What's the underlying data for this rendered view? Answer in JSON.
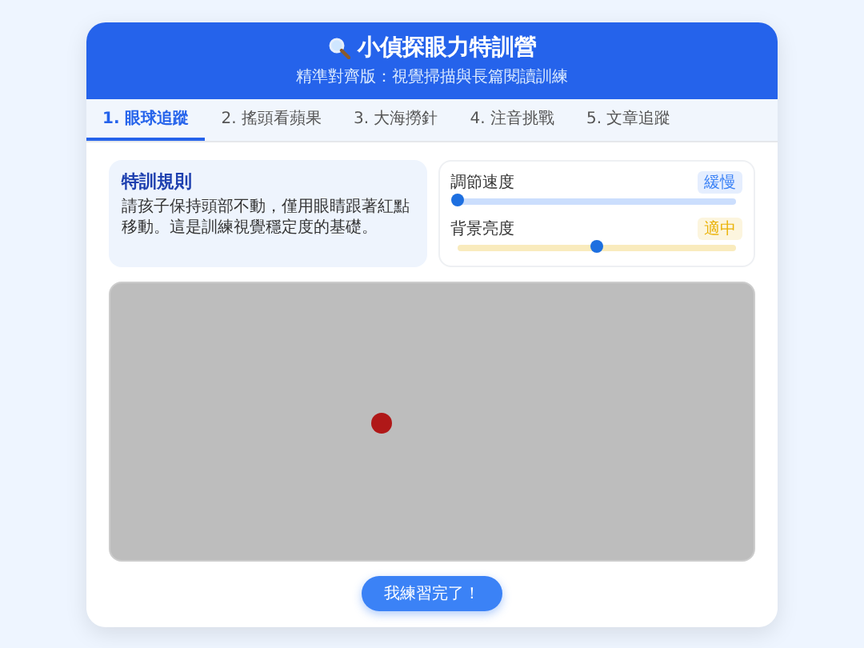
{
  "header": {
    "title": "小偵探眼力特訓營",
    "subtitle": "精準對齊版：視覺掃描與長篇閱讀訓練"
  },
  "tabs": [
    {
      "label": "1. 眼球追蹤",
      "selected": true
    },
    {
      "label": "2. 搖頭看蘋果",
      "selected": false
    },
    {
      "label": "3. 大海撈針",
      "selected": false
    },
    {
      "label": "4. 注音挑戰",
      "selected": false
    },
    {
      "label": "5. 文章追蹤",
      "selected": false
    }
  ],
  "rules": {
    "title": "特訓規則",
    "text": "請孩子保持頭部不動，僅用眼睛跟著紅點移動。這是訓練視覺穩定度的基礎。"
  },
  "sliders": [
    {
      "label": "調節速度",
      "badge": "緩慢",
      "level": 0.0,
      "kind": "speed"
    },
    {
      "label": "背景亮度",
      "badge": "適中",
      "level": 0.5,
      "kind": "brightness"
    }
  ],
  "finish_button": "我練習完了！"
}
